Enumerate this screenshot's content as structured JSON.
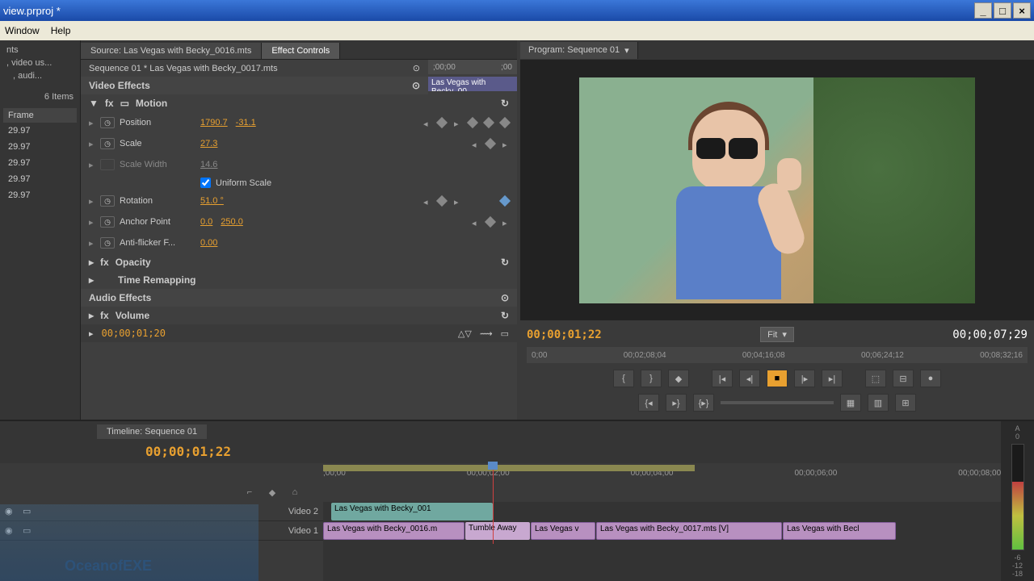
{
  "window": {
    "title": "view.prproj *",
    "menu": {
      "window": "Window",
      "help": "Help"
    }
  },
  "project_panel": {
    "item1": "nts",
    "item2": ", video us...",
    "item3": ", audi...",
    "count": "6 Items",
    "frame_header": "Frame",
    "rates": [
      "29.97",
      "29.97",
      "29.97",
      "29.97",
      "29.97"
    ]
  },
  "effect_panel": {
    "tabs": {
      "source": "Source: Las Vegas with Becky_0016.mts",
      "effect_controls": "Effect Controls"
    },
    "sequence_line": "Sequence 01 * Las Vegas with Becky_0017.mts",
    "mini_ruler": {
      "t1": ";00;00",
      "t2": ";00"
    },
    "mini_clip": "Las Vegas with Becky_00",
    "video_effects": "Video Effects",
    "motion": {
      "label": "Motion",
      "position": {
        "label": "Position",
        "x": "1790.7",
        "y": "-31.1"
      },
      "scale": {
        "label": "Scale",
        "value": "27.3"
      },
      "scale_width": {
        "label": "Scale Width",
        "value": "14.6"
      },
      "uniform": "Uniform Scale",
      "rotation": {
        "label": "Rotation",
        "value": "51.0 °"
      },
      "anchor": {
        "label": "Anchor Point",
        "x": "0.0",
        "y": "250.0"
      },
      "antiflicker": {
        "label": "Anti-flicker F...",
        "value": "0.00"
      }
    },
    "opacity": "Opacity",
    "time_remapping": "Time Remapping",
    "audio_effects": "Audio Effects",
    "volume": "Volume",
    "timecode": "00;00;01;20"
  },
  "program": {
    "tab": "Program: Sequence 01",
    "tc_left": "00;00;01;22",
    "tc_right": "00;00;07;29",
    "fit": "Fit",
    "ruler": [
      "0;00",
      "00;02;08;04",
      "00;04;16;08",
      "00;06;24;12",
      "00;08;32;16"
    ]
  },
  "timeline": {
    "tab": "Timeline: Sequence 01",
    "timecode": "00;00;01;22",
    "ruler": [
      ";00;00",
      "00;00;02;00",
      "00;00;04;00",
      "00;00;06;00",
      "00;00;08;00"
    ],
    "tracks": {
      "video2": "Video 2",
      "video1": "Video 1"
    },
    "clips": {
      "v2_clip1": "Las Vegas with Becky_001",
      "v1_clip1": "Las Vegas with Becky_0016.m",
      "v1_clip2": "Tumble Away",
      "v1_clip3": "Las Vegas v",
      "v1_clip4": "Las Vegas with Becky_0017.mts [V]",
      "v1_clip5": "Las Vegas with Becl"
    }
  },
  "audio_meter": {
    "a": "A",
    "zero": "0",
    "m6": "-6",
    "m12": "-12",
    "m18": "-18"
  },
  "watermark": "OceanofEXE"
}
